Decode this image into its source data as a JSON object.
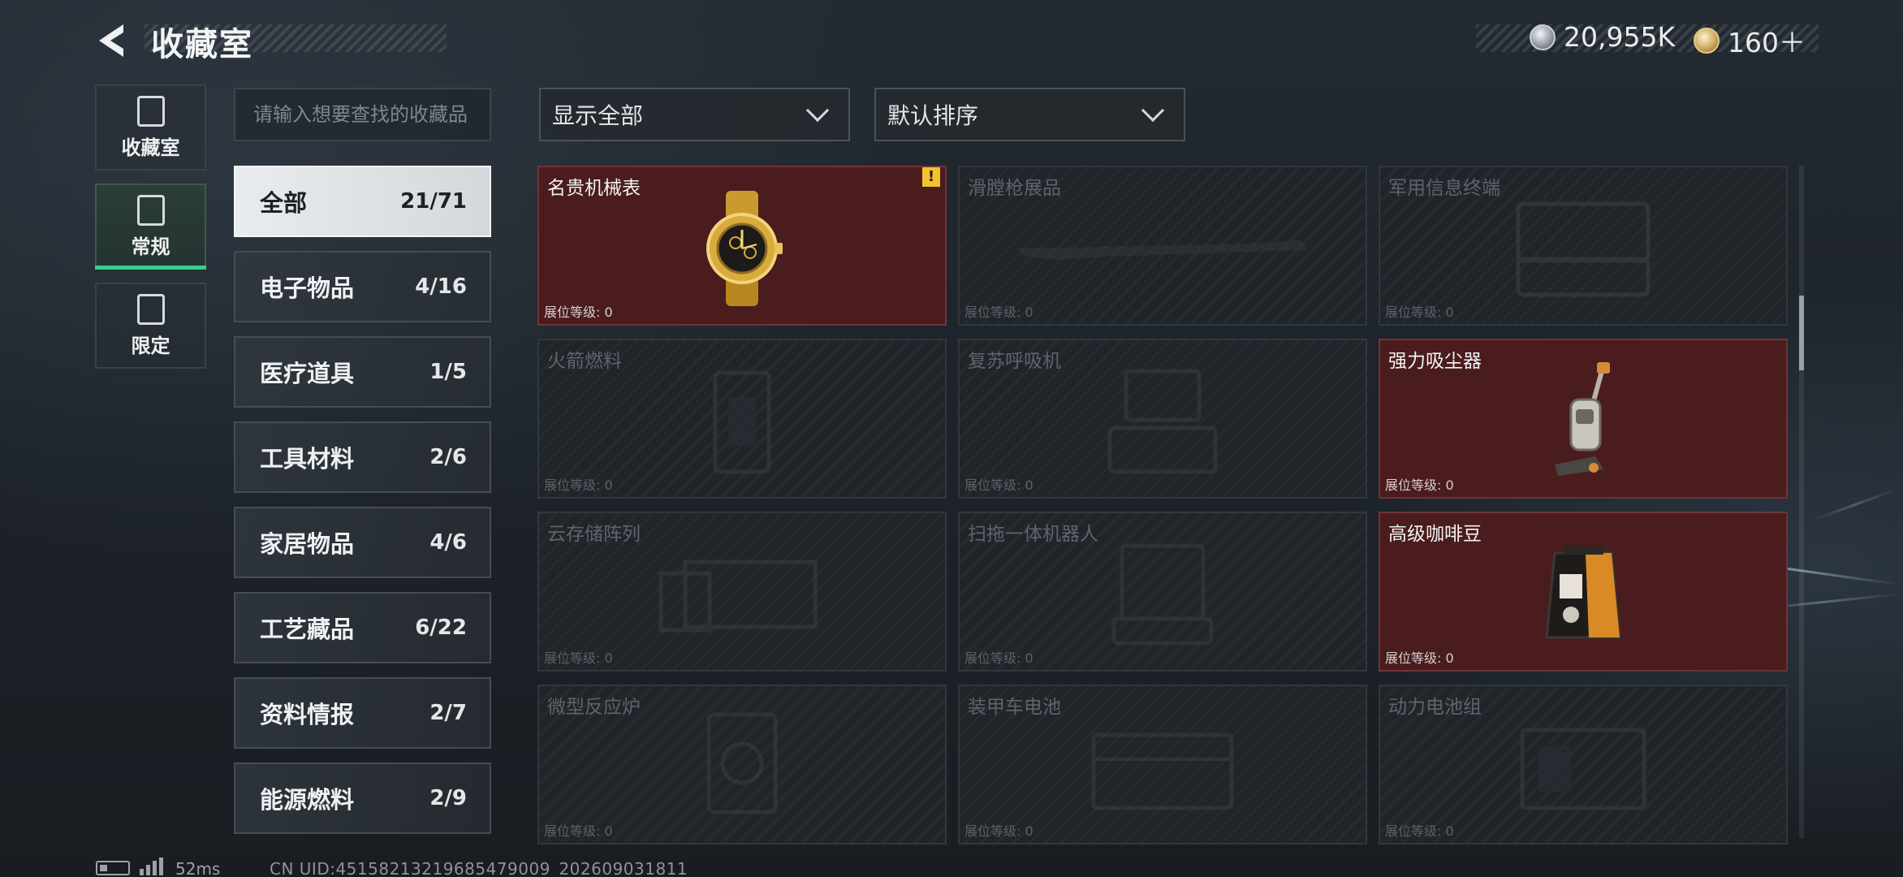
{
  "header": {
    "title": "收藏室",
    "currency_silver": "20,955K",
    "currency_gold": "160＋"
  },
  "rail": [
    {
      "label": "收藏室",
      "active": false
    },
    {
      "label": "常规",
      "active": true
    },
    {
      "label": "限定",
      "active": false
    }
  ],
  "search": {
    "placeholder": "请输入想要查找的收藏品"
  },
  "categories": [
    {
      "name": "全部",
      "count": "21/71",
      "active": true
    },
    {
      "name": "电子物品",
      "count": "4/16"
    },
    {
      "name": "医疗道具",
      "count": "1/5"
    },
    {
      "name": "工具材料",
      "count": "2/6"
    },
    {
      "name": "家居物品",
      "count": "4/6"
    },
    {
      "name": "工艺藏品",
      "count": "6/22"
    },
    {
      "name": "资料情报",
      "count": "2/7"
    },
    {
      "name": "能源燃料",
      "count": "2/9"
    }
  ],
  "filters": {
    "show": "显示全部",
    "sort": "默认排序"
  },
  "level_label": "展位等级: 0",
  "items": [
    {
      "name": "名贵机械表",
      "owned": true,
      "icon": "gold-watch-icon",
      "warning": "!"
    },
    {
      "name": "滑膛枪展品",
      "owned": false,
      "icon": "musket-icon"
    },
    {
      "name": "军用信息终端",
      "owned": false,
      "icon": "military-terminal-icon"
    },
    {
      "name": "火箭燃料",
      "owned": false,
      "icon": "rocket-fuel-icon"
    },
    {
      "name": "复苏呼吸机",
      "owned": false,
      "icon": "ventilator-icon"
    },
    {
      "name": "强力吸尘器",
      "owned": true,
      "icon": "vacuum-cleaner-icon"
    },
    {
      "name": "云存储阵列",
      "owned": false,
      "icon": "storage-array-icon"
    },
    {
      "name": "扫拖一体机器人",
      "owned": false,
      "icon": "robot-mop-icon"
    },
    {
      "name": "高级咖啡豆",
      "owned": true,
      "icon": "coffee-bag-icon"
    },
    {
      "name": "微型反应炉",
      "owned": false,
      "icon": "micro-reactor-icon"
    },
    {
      "name": "装甲车电池",
      "owned": false,
      "icon": "vehicle-battery-icon"
    },
    {
      "name": "动力电池组",
      "owned": false,
      "icon": "power-battery-pack-icon"
    }
  ],
  "footer": {
    "ping": "52ms",
    "uid": "CN UID:4515821321968547900​9_202609031811"
  }
}
